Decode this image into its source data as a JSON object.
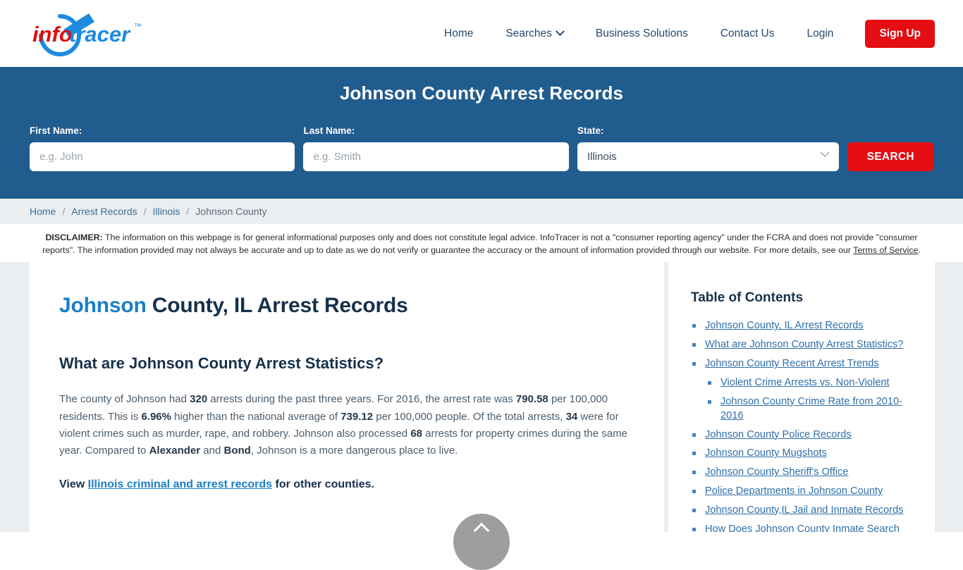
{
  "header": {
    "logo": {
      "part1": "info",
      "part2": "tracer",
      "tm": "™"
    },
    "nav": [
      {
        "label": "Home",
        "icon": null
      },
      {
        "label": "Searches",
        "icon": "chevron-down-icon"
      },
      {
        "label": "Business Solutions",
        "icon": null
      },
      {
        "label": "Contact Us",
        "icon": null
      },
      {
        "label": "Login",
        "icon": null
      }
    ],
    "signup_label": "Sign Up"
  },
  "banner": {
    "title": "Johnson County Arrest Records",
    "accent_color": "#215c8e",
    "first_name": {
      "label": "First Name:",
      "value": "",
      "placeholder": "e.g. John"
    },
    "last_name": {
      "label": "Last Name:",
      "value": "",
      "placeholder": "e.g. Smith"
    },
    "state": {
      "label": "State:",
      "value": "Illinois",
      "options": [
        "Illinois"
      ]
    },
    "search_label": "SEARCH",
    "search_color": "#e40d12"
  },
  "breadcrumb": {
    "items": [
      "Home",
      "Arrest Records",
      "Illinois",
      "Johnson County"
    ],
    "separator": "/"
  },
  "disclaimer": {
    "label": "DISCLAIMER:",
    "text_before_link": " The information on this webpage is for general informational purposes only and does not constitute legal advice. InfoTracer is not a \"consumer reporting agency\" under the FCRA and does not provide \"consumer reports\". The information provided may not always be accurate and up to date as we do not verify or guarantee the accuracy or the amount of information provided through our website. For more details, see our ",
    "link_text": "Terms of Service",
    "text_after_link": "."
  },
  "main": {
    "title_highlight": "Johnson",
    "title_rest": " County, IL Arrest Records",
    "subtitle": "What are Johnson County Arrest Statistics?",
    "paragraph": {
      "s1": "The county of Johnson had ",
      "b1": "320",
      "s2": " arrests during the past three years. For 2016, the arrest rate was ",
      "b2": "790.58",
      "s3": " per 100,000 residents. This is ",
      "b3": "6.96%",
      "s4": " higher than the national average of ",
      "b4": "739.12",
      "s5": " per 100,000 people. Of the total arrests, ",
      "b5": "34",
      "s6": " were for violent crimes such as murder, rape, and robbery. Johnson also processed ",
      "b6": "68",
      "s7": " arrests for property crimes during the same year. Compared to ",
      "b7": "Alexander",
      "s8": " and ",
      "b8": "Bond",
      "s9": ", Johnson is a more dangerous place to live."
    },
    "view_line": {
      "prefix": "View ",
      "link": "Illinois criminal and arrest records",
      "suffix": " for other counties."
    }
  },
  "toc": {
    "title": "Table of Contents",
    "items": [
      {
        "label": "Johnson County, IL Arrest Records"
      },
      {
        "label": "What are Johnson County Arrest Statistics?"
      },
      {
        "label": "Johnson County Recent Arrest Trends",
        "children": [
          {
            "label": "Violent Crime Arrests vs. Non-Violent"
          },
          {
            "label": "Johnson County Crime Rate from 2010-2016"
          }
        ]
      },
      {
        "label": "Johnson County Police Records"
      },
      {
        "label": "Johnson County Mugshots"
      },
      {
        "label": "Johnson County Sheriff's Office"
      },
      {
        "label": "Police Departments in Johnson County"
      },
      {
        "label": "Johnson County,IL Jail and Inmate Records"
      },
      {
        "label": "How Does Johnson County Inmate Search"
      }
    ]
  },
  "scroll_top": {
    "icon": "chevron-up-icon"
  }
}
